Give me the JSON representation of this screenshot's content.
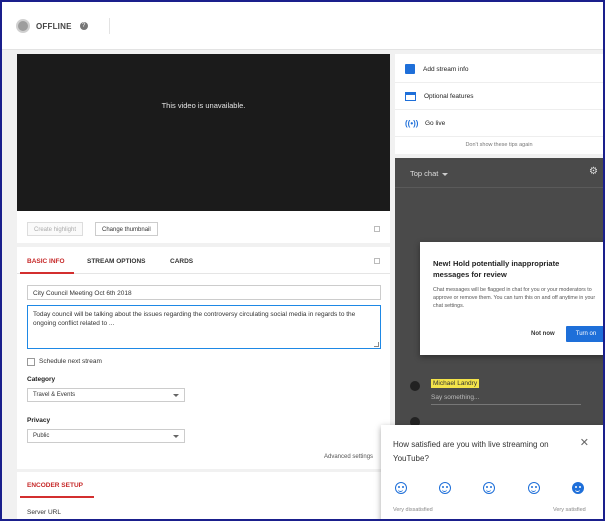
{
  "header": {
    "status": "OFFLINE",
    "help_icon": "help-circle-icon"
  },
  "player": {
    "message": "This video is unavailable.",
    "create_highlight": "Create highlight",
    "change_thumbnail": "Change thumbnail"
  },
  "tabs": [
    "BASIC INFO",
    "STREAM OPTIONS",
    "CARDS"
  ],
  "basic_info": {
    "title_value": "City Council Meeting Oct 6th 2018",
    "description_value": "Today council will be talking about the issues regarding the controversy circulating social media in regards to the ongoing conflict related to ...",
    "schedule_label": "Schedule next stream",
    "category_label": "Category",
    "category_value": "Travel & Events",
    "privacy_label": "Privacy",
    "privacy_value": "Public",
    "advanced_link": "Advanced settings"
  },
  "encoder": {
    "title": "ENCODER SETUP",
    "server_label": "Server URL"
  },
  "tips": {
    "items": [
      {
        "label": "Add stream info",
        "icon": "info-box-icon"
      },
      {
        "label": "Optional features",
        "icon": "card-icon"
      },
      {
        "label": "Go live",
        "icon": "live-icon"
      }
    ],
    "dont_show": "Don't show these tips again"
  },
  "chat": {
    "title": "Top chat",
    "popup_title": "New! Hold potentially inappropriate messages for review",
    "popup_body": "Chat messages will be flagged in chat for you or your moderators to approve or remove them. You can turn this on and off anytime in your chat settings.",
    "not_now": "Not now",
    "turn_on": "Turn on",
    "user_name": "Michael Landry",
    "input_placeholder": "Say something..."
  },
  "survey": {
    "question": "How satisfied are you with live streaming on YouTube?",
    "low_label": "Very dissatisfied",
    "high_label": "Very satisfied",
    "selected_rating": 5,
    "scale_max": 5
  },
  "colors": {
    "accent_red": "#d32f2f",
    "accent_blue": "#1e6fd9",
    "frame_border": "#1a1f8c"
  }
}
